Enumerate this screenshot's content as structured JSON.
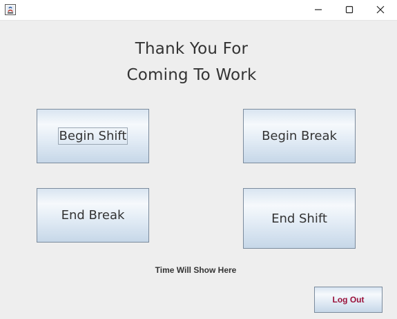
{
  "window": {
    "app_icon": "java-app-icon",
    "controls": {
      "minimize_icon": "minimize-icon",
      "maximize_icon": "maximize-icon",
      "close_icon": "close-icon"
    }
  },
  "main": {
    "heading_line1": "Thank You For",
    "heading_line2": "Coming To Work",
    "buttons": {
      "begin_shift": "Begin Shift",
      "begin_break": "Begin Break",
      "end_break": "End Break",
      "end_shift": "End Shift"
    },
    "time_label": "Time Will Show Here",
    "logout": "Log Out"
  },
  "colors": {
    "background": "#eeeeee",
    "text": "#333333",
    "logout_text": "#9a1039",
    "button_border": "#7a8a9c"
  }
}
